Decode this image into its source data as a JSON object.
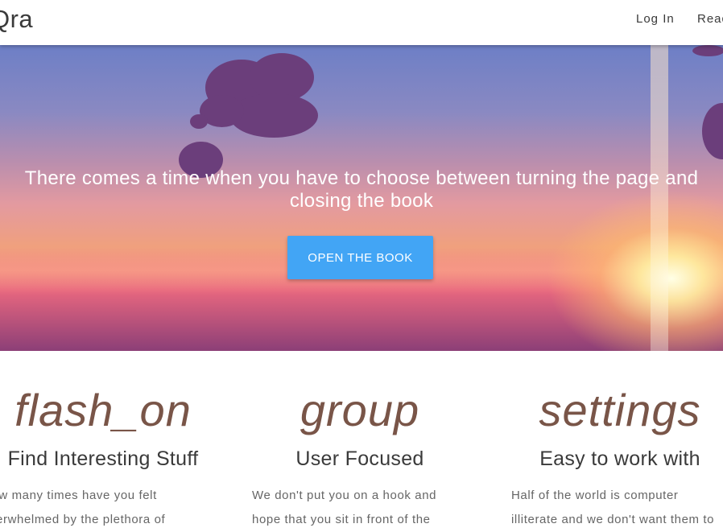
{
  "navbar": {
    "brand": "Qra",
    "links": [
      "Log In",
      "Read"
    ]
  },
  "hero": {
    "quote": "There comes a time when you have to choose between turning the page and closing the book",
    "cta_label": "OPEN THE BOOK"
  },
  "features": [
    {
      "icon": "flash_on",
      "title": "Find Interesting Stuff",
      "text": [
        "How many times have you felt",
        "overwhelmed by the plethora of"
      ]
    },
    {
      "icon": "group",
      "title": "User Focused",
      "text": [
        "We don't put you on a hook and",
        "hope that you sit in front of the"
      ]
    },
    {
      "icon": "settings",
      "title": "Easy to work with",
      "text": [
        "Half of the world is computer",
        "illiterate and we don't want them to"
      ]
    }
  ],
  "colors": {
    "accent": "#42a5f5",
    "icon": "#795548"
  }
}
